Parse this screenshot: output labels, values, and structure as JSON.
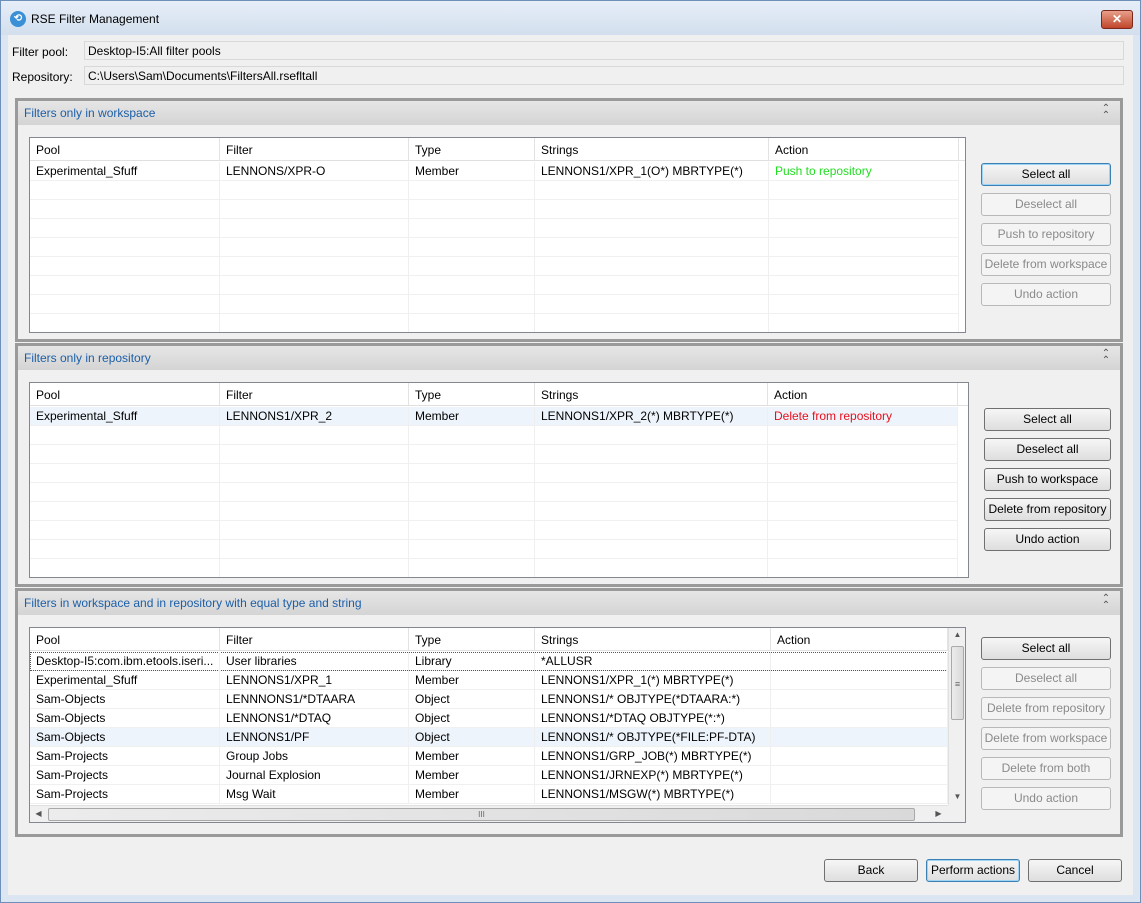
{
  "window": {
    "title": "RSE Filter Management",
    "icon": "rse-icon",
    "close_glyph": "✕"
  },
  "header": {
    "filter_pool_label": "Filter pool:",
    "filter_pool_value": "Desktop-I5:All filter pools",
    "repository_label": "Repository:",
    "repository_value": "C:\\Users\\Sam\\Documents\\FiltersAll.rsefltall"
  },
  "columns": [
    "Pool",
    "Filter",
    "Type",
    "Strings",
    "Action"
  ],
  "section1": {
    "title": "Filters only in workspace",
    "rows": [
      {
        "pool": "Experimental_Sfuff",
        "filter": "LENNONS/XPR-O",
        "type": "Member",
        "strings": "LENNONS1/XPR_1(O*) MBRTYPE(*)",
        "action": "Push to repository"
      }
    ],
    "buttons": [
      "Select all",
      "Deselect all",
      "Push to repository",
      "Delete from workspace",
      "Undo action"
    ]
  },
  "section2": {
    "title": "Filters only in repository",
    "rows": [
      {
        "pool": "Experimental_Sfuff",
        "filter": "LENNONS1/XPR_2",
        "type": "Member",
        "strings": "LENNONS1/XPR_2(*) MBRTYPE(*)",
        "action": "Delete from repository"
      }
    ],
    "buttons": [
      "Select all",
      "Deselect all",
      "Push to workspace",
      "Delete from repository",
      "Undo action"
    ]
  },
  "section3": {
    "title": "Filters in workspace and in repository with equal type and string",
    "rows": [
      {
        "pool": "Desktop-I5:com.ibm.etools.iseri...",
        "filter": "User libraries",
        "type": "Library",
        "strings": "*ALLUSR",
        "action": ""
      },
      {
        "pool": "Experimental_Sfuff",
        "filter": "LENNONS1/XPR_1",
        "type": "Member",
        "strings": "LENNONS1/XPR_1(*) MBRTYPE(*)",
        "action": ""
      },
      {
        "pool": "Sam-Objects",
        "filter": "LENNNONS1/*DTAARA",
        "type": "Object",
        "strings": "LENNONS1/* OBJTYPE(*DTAARA:*)",
        "action": ""
      },
      {
        "pool": "Sam-Objects",
        "filter": "LENNONS1/*DTAQ",
        "type": "Object",
        "strings": "LENNONS1/*DTAQ OBJTYPE(*:*)",
        "action": ""
      },
      {
        "pool": "Sam-Objects",
        "filter": "LENNONS1/PF",
        "type": "Object",
        "strings": "LENNONS1/* OBJTYPE(*FILE:PF-DTA)",
        "action": ""
      },
      {
        "pool": "Sam-Projects",
        "filter": "Group Jobs",
        "type": "Member",
        "strings": "LENNONS1/GRP_JOB(*) MBRTYPE(*)",
        "action": ""
      },
      {
        "pool": "Sam-Projects",
        "filter": "Journal Explosion",
        "type": "Member",
        "strings": "LENNONS1/JRNEXP(*) MBRTYPE(*)",
        "action": ""
      },
      {
        "pool": "Sam-Projects",
        "filter": "Msg Wait",
        "type": "Member",
        "strings": "LENNONS1/MSGW(*) MBRTYPE(*)",
        "action": ""
      }
    ],
    "buttons": [
      "Select all",
      "Deselect all",
      "Delete from repository",
      "Delete from workspace",
      "Delete from both",
      "Undo action"
    ],
    "scroll_grip": "≡",
    "hscroll_grip": "III"
  },
  "footer": {
    "back": "Back",
    "perform": "Perform actions",
    "cancel": "Cancel"
  },
  "colors": {
    "section_title": "#1c5fa8",
    "push_action": "#22dd22",
    "delete_action": "#e8101c"
  },
  "icons": {
    "collapse": "collapse-icon"
  }
}
